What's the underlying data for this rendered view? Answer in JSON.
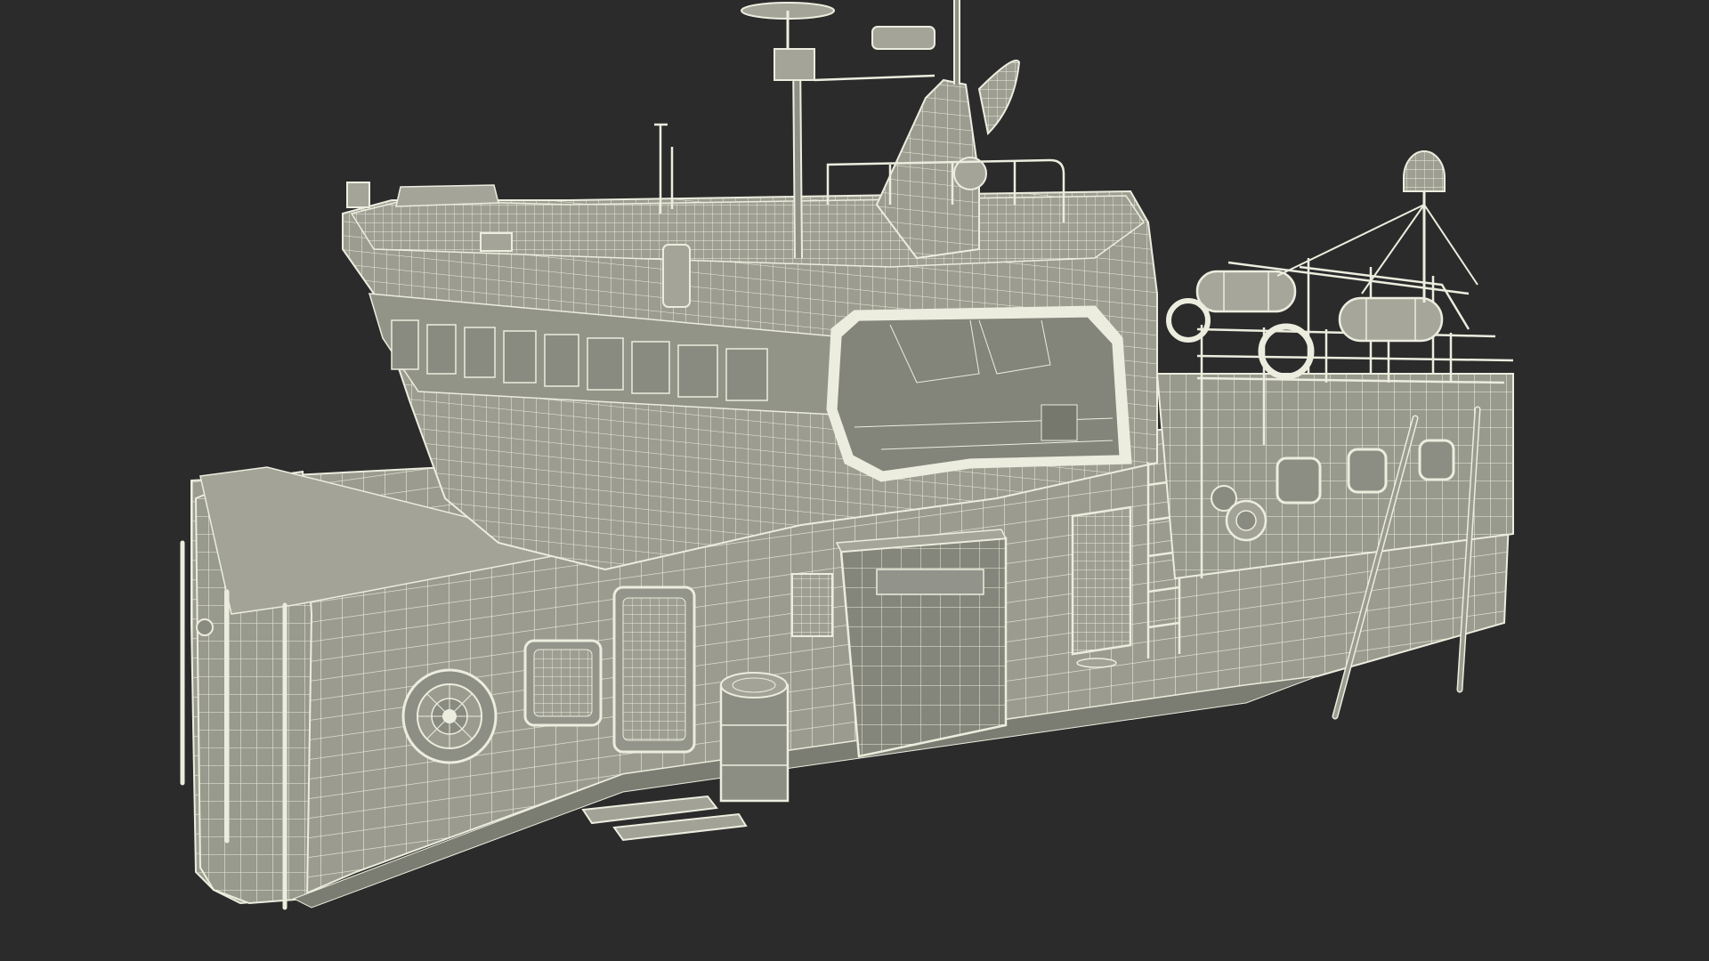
{
  "scene": {
    "subject": "ship-superstructure-wireframe",
    "background_color": "#2b2b2c",
    "surface_color": "#9b9c8f",
    "surface_shade_color": "#8d8e83",
    "wire_color": "#ecedde",
    "dark_panel_color": "#6f7066"
  }
}
